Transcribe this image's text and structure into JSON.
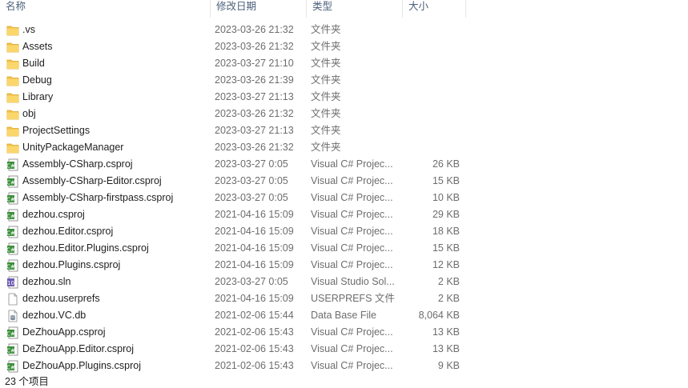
{
  "columns": {
    "name": "名称",
    "modified": "修改日期",
    "type": "类型",
    "size": "大小"
  },
  "files": [
    {
      "icon": "folder-icon",
      "name": ".vs",
      "modified": "2023-03-26 21:32",
      "type": "文件夹",
      "size": ""
    },
    {
      "icon": "folder-icon",
      "name": "Assets",
      "modified": "2023-03-26 21:32",
      "type": "文件夹",
      "size": ""
    },
    {
      "icon": "folder-icon",
      "name": "Build",
      "modified": "2023-03-27 21:10",
      "type": "文件夹",
      "size": ""
    },
    {
      "icon": "folder-icon",
      "name": "Debug",
      "modified": "2023-03-26 21:39",
      "type": "文件夹",
      "size": ""
    },
    {
      "icon": "folder-icon",
      "name": "Library",
      "modified": "2023-03-27 21:13",
      "type": "文件夹",
      "size": ""
    },
    {
      "icon": "folder-icon",
      "name": "obj",
      "modified": "2023-03-26 21:32",
      "type": "文件夹",
      "size": ""
    },
    {
      "icon": "folder-icon",
      "name": "ProjectSettings",
      "modified": "2023-03-27 21:13",
      "type": "文件夹",
      "size": ""
    },
    {
      "icon": "folder-icon",
      "name": "UnityPackageManager",
      "modified": "2023-03-26 21:32",
      "type": "文件夹",
      "size": ""
    },
    {
      "icon": "csproj-icon",
      "name": "Assembly-CSharp.csproj",
      "modified": "2023-03-27 0:05",
      "type": "Visual C# Projec...",
      "size": "26 KB"
    },
    {
      "icon": "csproj-icon",
      "name": "Assembly-CSharp-Editor.csproj",
      "modified": "2023-03-27 0:05",
      "type": "Visual C# Projec...",
      "size": "15 KB"
    },
    {
      "icon": "csproj-icon",
      "name": "Assembly-CSharp-firstpass.csproj",
      "modified": "2023-03-27 0:05",
      "type": "Visual C# Projec...",
      "size": "10 KB"
    },
    {
      "icon": "csproj-icon",
      "name": "dezhou.csproj",
      "modified": "2021-04-16 15:09",
      "type": "Visual C# Projec...",
      "size": "29 KB"
    },
    {
      "icon": "csproj-icon",
      "name": "dezhou.Editor.csproj",
      "modified": "2021-04-16 15:09",
      "type": "Visual C# Projec...",
      "size": "18 KB"
    },
    {
      "icon": "csproj-icon",
      "name": "dezhou.Editor.Plugins.csproj",
      "modified": "2021-04-16 15:09",
      "type": "Visual C# Projec...",
      "size": "15 KB"
    },
    {
      "icon": "csproj-icon",
      "name": "dezhou.Plugins.csproj",
      "modified": "2021-04-16 15:09",
      "type": "Visual C# Projec...",
      "size": "12 KB"
    },
    {
      "icon": "sln-icon",
      "name": "dezhou.sln",
      "modified": "2023-03-27 0:05",
      "type": "Visual Studio Sol...",
      "size": "2 KB"
    },
    {
      "icon": "file-icon",
      "name": "dezhou.userprefs",
      "modified": "2021-04-16 15:09",
      "type": "USERPREFS 文件",
      "size": "2 KB"
    },
    {
      "icon": "db-file-icon",
      "name": "dezhou.VC.db",
      "modified": "2021-02-06 15:44",
      "type": "Data Base File",
      "size": "8,064 KB"
    },
    {
      "icon": "csproj-icon",
      "name": "DeZhouApp.csproj",
      "modified": "2021-02-06 15:43",
      "type": "Visual C# Projec...",
      "size": "13 KB"
    },
    {
      "icon": "csproj-icon",
      "name": "DeZhouApp.Editor.csproj",
      "modified": "2021-02-06 15:43",
      "type": "Visual C# Projec...",
      "size": "13 KB"
    },
    {
      "icon": "csproj-icon",
      "name": "DeZhouApp.Plugins.csproj",
      "modified": "2021-02-06 15:43",
      "type": "Visual C# Projec...",
      "size": "9 KB"
    }
  ],
  "status": {
    "item_count": "23 个项目"
  },
  "colors": {
    "folder": "#f4c24a",
    "csproj_accent": "#3a8f3a",
    "header_text": "#4c607a"
  }
}
